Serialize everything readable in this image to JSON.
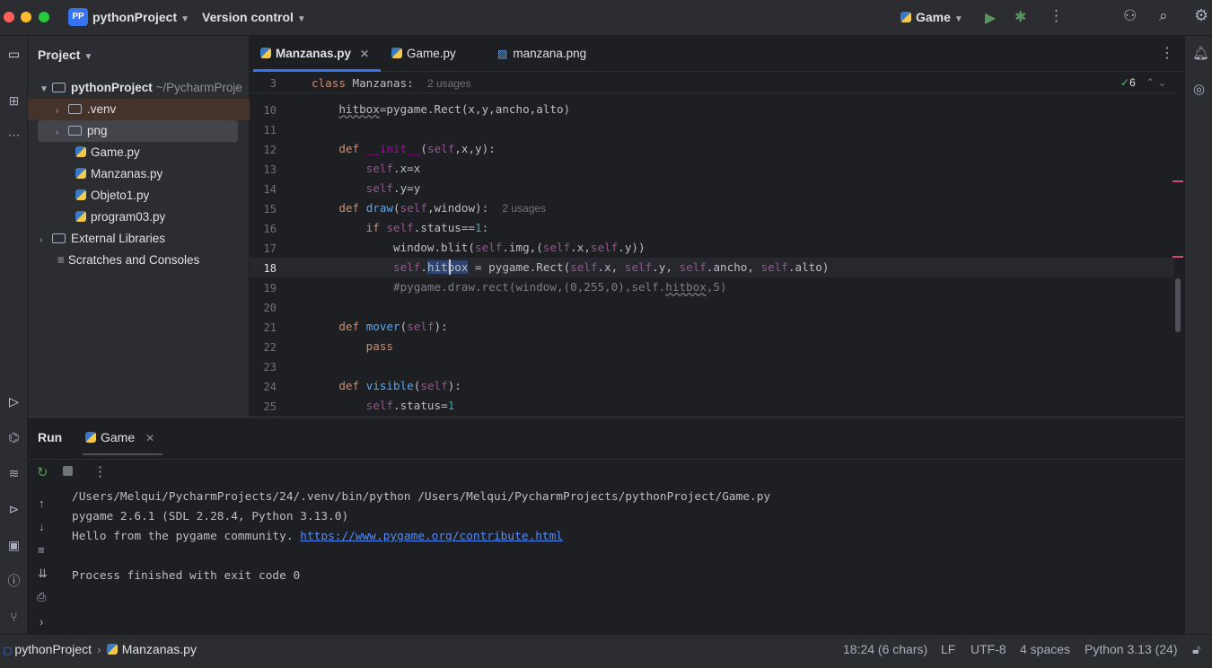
{
  "titlebar": {
    "project_badge": "PP",
    "project_name": "pythonProject",
    "vcs": "Version control",
    "run_config": "Game"
  },
  "project_panel": {
    "title": "Project",
    "root_name": "pythonProject",
    "root_path": "~/PycharmProje",
    "items": {
      "venv": ".venv",
      "png": "png",
      "game": "Game.py",
      "manzanas": "Manzanas.py",
      "objeto": "Objeto1.py",
      "program": "program03.py",
      "ext": "External Libraries",
      "scratch": "Scratches and Consoles"
    }
  },
  "tabs": {
    "t0": "Manzanas.py",
    "t1": "Game.py",
    "t2": "manzana.png"
  },
  "editor": {
    "sticky_num": "3",
    "sticky_class": "class",
    "sticky_name": "Manzanas:",
    "sticky_hint": "2 usages",
    "inspections": "6",
    "line_numbers": [
      "10",
      "11",
      "12",
      "13",
      "14",
      "15",
      "16",
      "17",
      "18",
      "19",
      "20",
      "21",
      "22",
      "23",
      "24",
      "25"
    ],
    "draw_hint": "2 usages"
  },
  "run_panel": {
    "title": "Run",
    "tab": "Game",
    "lines": {
      "l0": "/Users/Melqui/PycharmProjects/24/.venv/bin/python /Users/Melqui/PycharmProjects/pythonProject/Game.py",
      "l1": "pygame 2.6.1 (SDL 2.28.4, Python 3.13.0)",
      "l2": "Hello from the pygame community. ",
      "l2_link": "https://www.pygame.org/contribute.html",
      "l3": "Process finished with exit code 0"
    }
  },
  "statusbar": {
    "crumb_project": "pythonProject",
    "crumb_file": "Manzanas.py",
    "position": "18:24 (6 chars)",
    "line_sep": "LF",
    "encoding": "UTF-8",
    "indent": "4 spaces",
    "interpreter": "Python 3.13 (24)"
  },
  "colors": {
    "accent": "#3574f0",
    "selection": "#2e436e",
    "keyword": "#cf8e6d",
    "function": "#56a8f5",
    "self": "#94558d",
    "number": "#2aacb8"
  }
}
